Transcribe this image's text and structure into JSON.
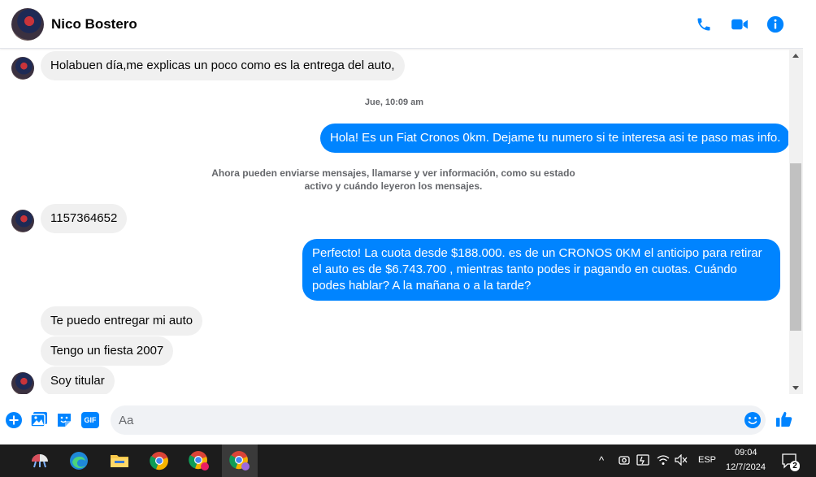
{
  "header": {
    "contact_name": "Nico Bostero",
    "icons": [
      "phone-icon",
      "video-camera-icon",
      "info-icon"
    ],
    "accent": "#0084ff"
  },
  "messages": [
    {
      "side": "in",
      "text": "Holabuen día,me explicas un poco como es la entrega del auto,"
    },
    {
      "type": "timestamp",
      "text": "Jue, 10:09 am"
    },
    {
      "side": "out",
      "text": "Hola! Es un Fiat Cronos 0km. Dejame tu numero si te interesa asi te paso mas info."
    },
    {
      "type": "system",
      "line1": "Ahora pueden enviarse mensajes, llamarse y ver información, como su estado",
      "line2": "activo y cuándo leyeron los mensajes."
    },
    {
      "side": "in",
      "text": "1157364652"
    },
    {
      "side": "out",
      "text": "Perfecto! La cuota desde $188.000. es de un CRONOS 0KM el anticipo para retirar el auto es de $6.743.700 , mientras tanto podes ir pagando en cuotas. Cuándo podes hablar? A la mañana o a la tarde?"
    },
    {
      "side": "in",
      "text": "Te puedo entregar mi auto"
    },
    {
      "side": "in",
      "text": "Tengo un fiesta 2007"
    },
    {
      "side": "in",
      "text": "Soy titular"
    }
  ],
  "composer": {
    "placeholder": "Aa",
    "icons": [
      "plus-icon",
      "image-icon",
      "sticker-icon",
      "gif-icon",
      "emoji-icon",
      "thumbs-up-icon"
    ],
    "gif_label": "GIF"
  },
  "taskbar": {
    "apps": [
      "weather-icon",
      "edge-icon",
      "file-explorer-icon",
      "chrome-icon",
      "chrome-profile-icon",
      "chrome-active-icon"
    ],
    "language": "ESP",
    "time": "09:04",
    "date": "12/7/2024",
    "notifications": "2"
  }
}
